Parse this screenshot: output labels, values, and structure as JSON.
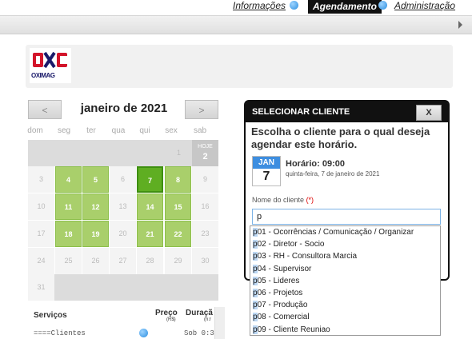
{
  "nav": {
    "informacoes": "Informações",
    "agendamento": "Agendamento",
    "administracao": "Administração"
  },
  "logo_text": "OXIMAG",
  "calendar": {
    "prev": "<",
    "next": ">",
    "month_title": "janeiro de 2021",
    "weekdays": [
      "dom",
      "seg",
      "ter",
      "qua",
      "qui",
      "sex",
      "sab"
    ],
    "today_label": "HOJE",
    "days": {
      "d1": "1",
      "d2": "2",
      "d3": "3",
      "d4": "4",
      "d5": "5",
      "d6": "6",
      "d7": "7",
      "d8": "8",
      "d9": "9",
      "d10": "10",
      "d11": "11",
      "d12": "12",
      "d13": "13",
      "d14": "14",
      "d15": "15",
      "d16": "16",
      "d17": "17",
      "d18": "18",
      "d19": "19",
      "d20": "20",
      "d21": "21",
      "d22": "22",
      "d23": "23",
      "d24": "24",
      "d25": "25",
      "d26": "26",
      "d27": "27",
      "d28": "28",
      "d29": "29",
      "d30": "30",
      "d31": "31"
    }
  },
  "services": {
    "col_servicos": "Serviços",
    "col_preco": "Preço",
    "col_preco_unit": "(R$)",
    "col_duracao": "Duraçã",
    "col_duracao_unit": "(h:r",
    "row1_name": "====Clientes",
    "row1_val": "Sob 0:3"
  },
  "panel": {
    "title": "SELECIONAR CLIENTE",
    "close": "X",
    "prompt": "Escolha o cliente para o qual deseja agendar este horário.",
    "month": "JAN",
    "day": "7",
    "horario": "Horário: 09:00",
    "data": "quinta-feira, 7 de janeiro de 2021",
    "field_label": "Nome do cliente",
    "field_req": "(*)",
    "field_value": "p"
  },
  "options": [
    {
      "hl": "p",
      "rest": "01 - Ocorrências / Comunicação / Organizar"
    },
    {
      "hl": "p",
      "rest": "02 - Diretor - Socio"
    },
    {
      "hl": "p",
      "rest": "03 - RH - Consultora Marcia"
    },
    {
      "hl": "p",
      "rest": "04 - Supervisor"
    },
    {
      "hl": "p",
      "rest": "05 - Lideres"
    },
    {
      "hl": "p",
      "rest": "06 - Projetos"
    },
    {
      "hl": "p",
      "rest": "07 - Produção"
    },
    {
      "hl": "p",
      "rest": "08 - Comercial"
    },
    {
      "hl": "p",
      "rest": "09 - Cliente Reuniao"
    }
  ],
  "colors": {
    "available_day": "#a9cf6b",
    "selected_day": "#5fae22",
    "header_black": "#111111",
    "highlight": "#bcd7f3"
  }
}
